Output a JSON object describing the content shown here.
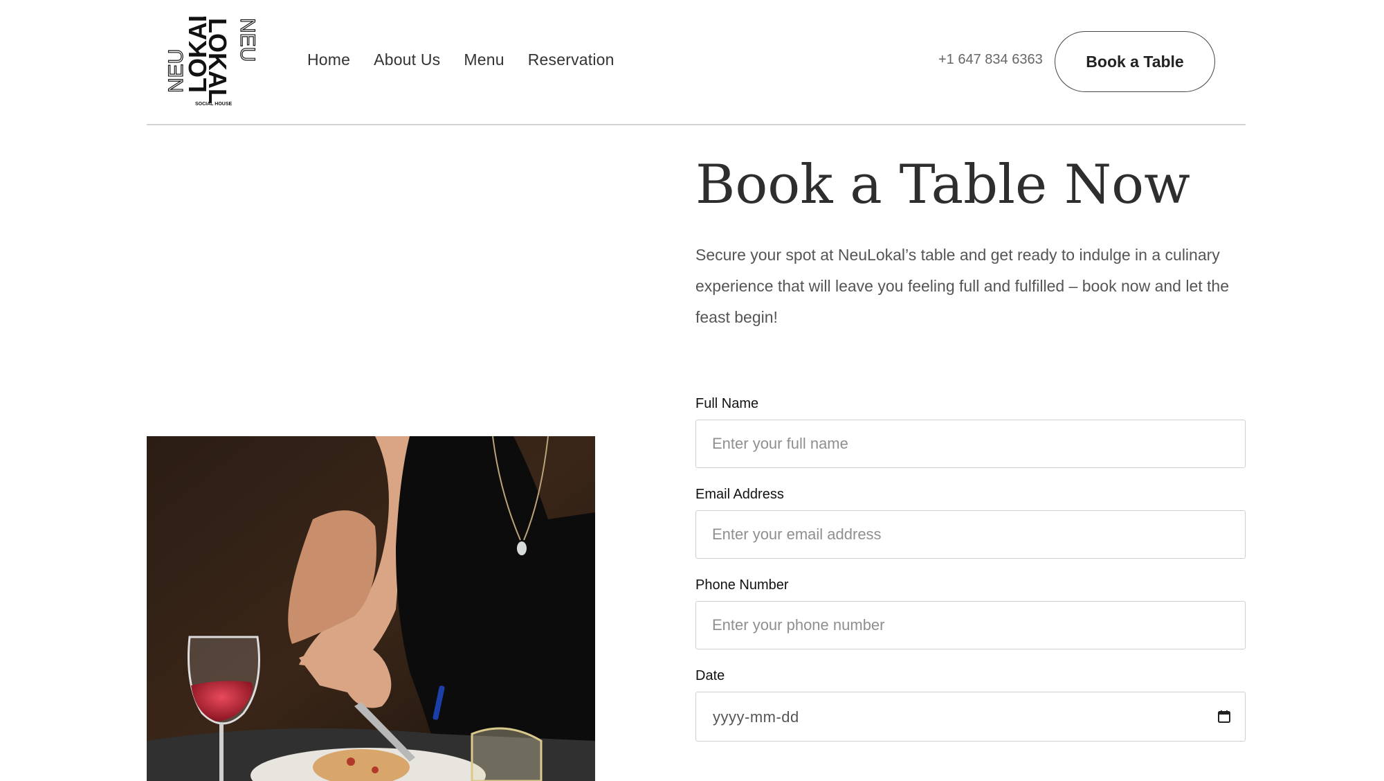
{
  "header": {
    "logo": {
      "word_top": "NEU",
      "word_main": "LOKAL",
      "tagline": "SOCIAL HOUSE"
    },
    "nav": [
      "Home",
      "About Us",
      "Menu",
      "Reservation"
    ],
    "phone": "+1 647 834 6363",
    "cta_label": "Book a Table"
  },
  "hero": {
    "title": "Book a Table Now",
    "description": "Secure your spot at NeuLokal’s table and get ready to indulge in a culinary experience that will leave you feeling full and fulfilled – book now and let the feast begin!"
  },
  "form": {
    "full_name": {
      "label": "Full Name",
      "placeholder": "Enter your full name"
    },
    "email": {
      "label": "Email Address",
      "placeholder": "Enter your email address"
    },
    "phone": {
      "label": "Phone Number",
      "placeholder": "Enter your phone number"
    },
    "date": {
      "label": "Date",
      "placeholder": "yyyy-mm-dd"
    }
  },
  "colors": {
    "text_dark": "#2e2e2e",
    "text_muted": "#555555",
    "border": "#cfcfcf",
    "divider": "#d4d4d4"
  },
  "icons": {
    "calendar": "calendar-icon"
  }
}
